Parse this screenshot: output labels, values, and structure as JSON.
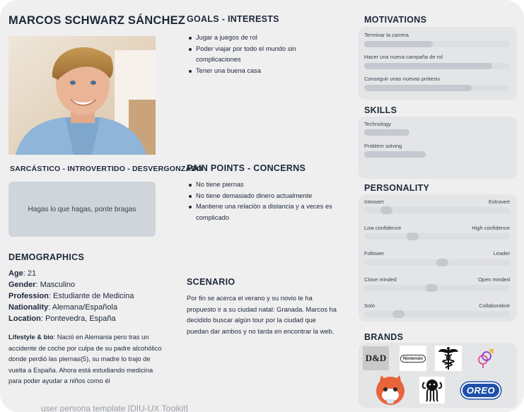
{
  "persona": {
    "name": "MARCOS SCHWARZ SÁNCHEZ",
    "traits": "SARCÁSTICO - INTROVERTIDO - DESVERGONZADO",
    "quote": "Hagas lo que hagas, ponte bragas"
  },
  "goals": {
    "title": "GOALS - INTERESTS",
    "items": [
      "Jugar a juegos de rol",
      "Poder viajar por todo el mundo sin complicaciones",
      "Tener una buena casa"
    ]
  },
  "pain_points": {
    "title": "PAIN POINTS - CONCERNS",
    "items": [
      "No tiene piernas",
      "No tiene demasiado dinero actualmente",
      "Mantiene una relación a distancia y a veces es complicado"
    ]
  },
  "demographics": {
    "title": "DEMOGRAPHICS",
    "age_label": "Age",
    "age": "21",
    "gender_label": "Gender",
    "gender": "Masculino",
    "profession_label": "Profession",
    "profession": "Estudiante de Medicina",
    "nationality_label": "Nationality",
    "nationality": "Alemana/Española",
    "location_label": "Location",
    "location": "Pontevedra, España",
    "bio_label": "Lifestyle & bio",
    "bio": "Nació en Alemania pero tras un accidente de coche por culpa de su padre alcohólico donde perdió las piernas(5), su madre lo trajo de vuelta a España. Ahora está estudiando medicina para poder ayudar a niños como él"
  },
  "scenario": {
    "title": "SCENARIO",
    "text": "Por fin se acerca el verano y su novio le ha propuesto ir a su ciudad natal: Granada. Marcos ha decidido buscar algún tour por la ciudad que puedan dar ambos y no tarda en encontrar la web."
  },
  "motivations": {
    "title": "MOTIVATIONS",
    "items": [
      {
        "label": "Terminar la carrera",
        "level": 0.47
      },
      {
        "label": "Hacer una nueva campaña de rol",
        "level": 0.88
      },
      {
        "label": "Conseguir unas nuevas prótesis",
        "level": 0.74
      }
    ]
  },
  "skills": {
    "title": "SKILLS",
    "items": [
      {
        "label": "Technology",
        "level": 0.31
      },
      {
        "label": "Problem solving",
        "level": 0.42
      }
    ]
  },
  "personality": {
    "title": "PERSONALITY",
    "items": [
      {
        "left": "Introvert",
        "right": "Extrovert",
        "level": 0.12
      },
      {
        "left": "Low confidence",
        "right": "High confidence",
        "level": 0.32
      },
      {
        "left": "Follower",
        "right": "Leader",
        "level": 0.54
      },
      {
        "left": "Close minded",
        "right": "Open minded",
        "level": 0.46
      },
      {
        "left": "Solo",
        "right": "Collaborative",
        "level": 0.21
      }
    ]
  },
  "brands": {
    "title": "BRANDS",
    "items": [
      "D&D",
      "Nintendo",
      "",
      "",
      "",
      "",
      "OREO"
    ]
  },
  "colors": {
    "background": "#efeff0",
    "panel": "#e4e5e7",
    "bar": "#c3c9cf",
    "track": "#dcdee1",
    "quote_box": "#cfd5da",
    "text": "#1d2838"
  },
  "footer": {
    "watermark": "user persona template [DIU-UX Toolkit]"
  }
}
